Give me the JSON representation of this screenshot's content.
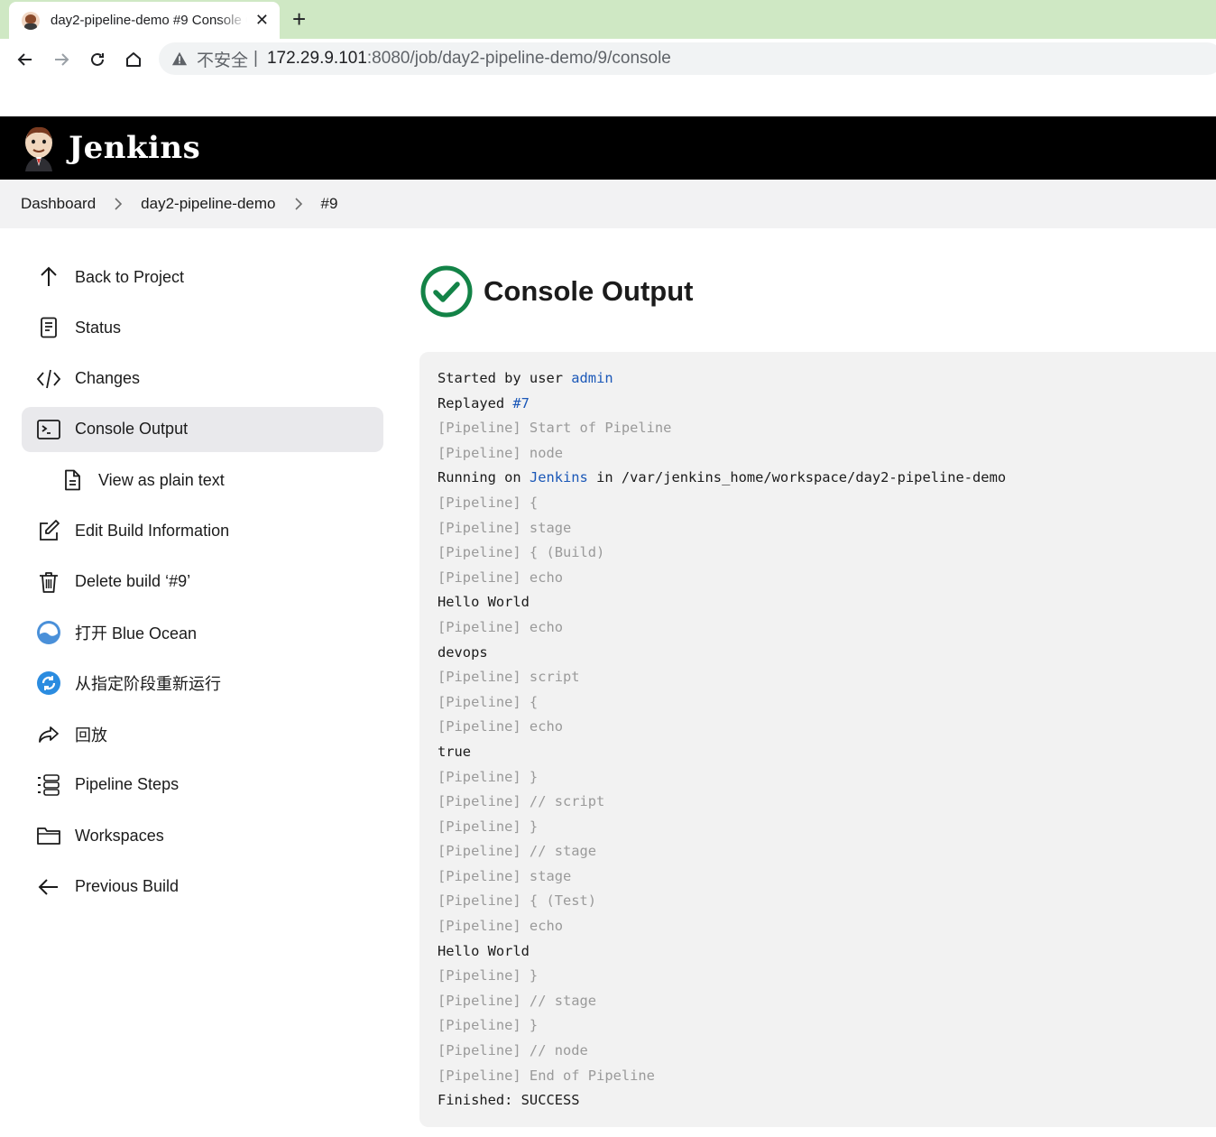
{
  "browser": {
    "tab_title": "day2-pipeline-demo #9 Console Output [Jenkins]",
    "new_tab_symbol": "+",
    "close_symbol": "✕",
    "insecure_label": "不安全",
    "separator": "|",
    "url_host": "172.29.9.101",
    "url_rest": ":8080/job/day2-pipeline-demo/9/console"
  },
  "header": {
    "title": "Jenkins"
  },
  "breadcrumb": {
    "items": [
      "Dashboard",
      "day2-pipeline-demo",
      "#9"
    ]
  },
  "sidebar": {
    "items": [
      {
        "label": "Back to Project",
        "icon": "arrow-up-icon"
      },
      {
        "label": "Status",
        "icon": "document-icon"
      },
      {
        "label": "Changes",
        "icon": "code-icon"
      },
      {
        "label": "Console Output",
        "icon": "terminal-icon",
        "active": true
      },
      {
        "label": "View as plain text",
        "icon": "file-text-icon"
      },
      {
        "label": "Edit Build Information",
        "icon": "edit-icon"
      },
      {
        "label": "Delete build ‘#9’",
        "icon": "trash-icon"
      },
      {
        "label": "打开 Blue Ocean",
        "icon": "blue-ocean-icon"
      },
      {
        "label": "从指定阶段重新运行",
        "icon": "restart-stage-icon"
      },
      {
        "label": "回放",
        "icon": "replay-icon"
      },
      {
        "label": "Pipeline Steps",
        "icon": "list-icon"
      },
      {
        "label": "Workspaces",
        "icon": "folder-icon"
      },
      {
        "label": "Previous Build",
        "icon": "arrow-left-icon"
      }
    ]
  },
  "main": {
    "title": "Console Output",
    "status_icon": "success-check-icon",
    "status_color": "#138347"
  },
  "console": {
    "line1_text": "Started by user ",
    "line1_link": "admin",
    "line2_text": "Replayed ",
    "line2_link": "#7",
    "line5_pre": "Running on ",
    "line5_link": "Jenkins",
    "line5_post": " in /var/jenkins_home/workspace/day2-pipeline-demo",
    "lines": [
      {
        "text": "[Pipeline] Start of Pipeline",
        "dim": true
      },
      {
        "text": "[Pipeline] node",
        "dim": true
      }
    ],
    "lines_after": [
      {
        "text": "[Pipeline] {",
        "dim": true
      },
      {
        "text": "[Pipeline] stage",
        "dim": true
      },
      {
        "text": "[Pipeline] { (Build)",
        "dim": true
      },
      {
        "text": "[Pipeline] echo",
        "dim": true
      },
      {
        "text": "Hello World",
        "dim": false
      },
      {
        "text": "[Pipeline] echo",
        "dim": true
      },
      {
        "text": "devops",
        "dim": false
      },
      {
        "text": "[Pipeline] script",
        "dim": true
      },
      {
        "text": "[Pipeline] {",
        "dim": true
      },
      {
        "text": "[Pipeline] echo",
        "dim": true
      },
      {
        "text": "true",
        "dim": false
      },
      {
        "text": "[Pipeline] }",
        "dim": true
      },
      {
        "text": "[Pipeline] // script",
        "dim": true
      },
      {
        "text": "[Pipeline] }",
        "dim": true
      },
      {
        "text": "[Pipeline] // stage",
        "dim": true
      },
      {
        "text": "[Pipeline] stage",
        "dim": true
      },
      {
        "text": "[Pipeline] { (Test)",
        "dim": true
      },
      {
        "text": "[Pipeline] echo",
        "dim": true
      },
      {
        "text": "Hello World",
        "dim": false
      },
      {
        "text": "[Pipeline] }",
        "dim": true
      },
      {
        "text": "[Pipeline] // stage",
        "dim": true
      },
      {
        "text": "[Pipeline] }",
        "dim": true
      },
      {
        "text": "[Pipeline] // node",
        "dim": true
      },
      {
        "text": "[Pipeline] End of Pipeline",
        "dim": true
      },
      {
        "text": "Finished: SUCCESS",
        "dim": false
      }
    ]
  }
}
